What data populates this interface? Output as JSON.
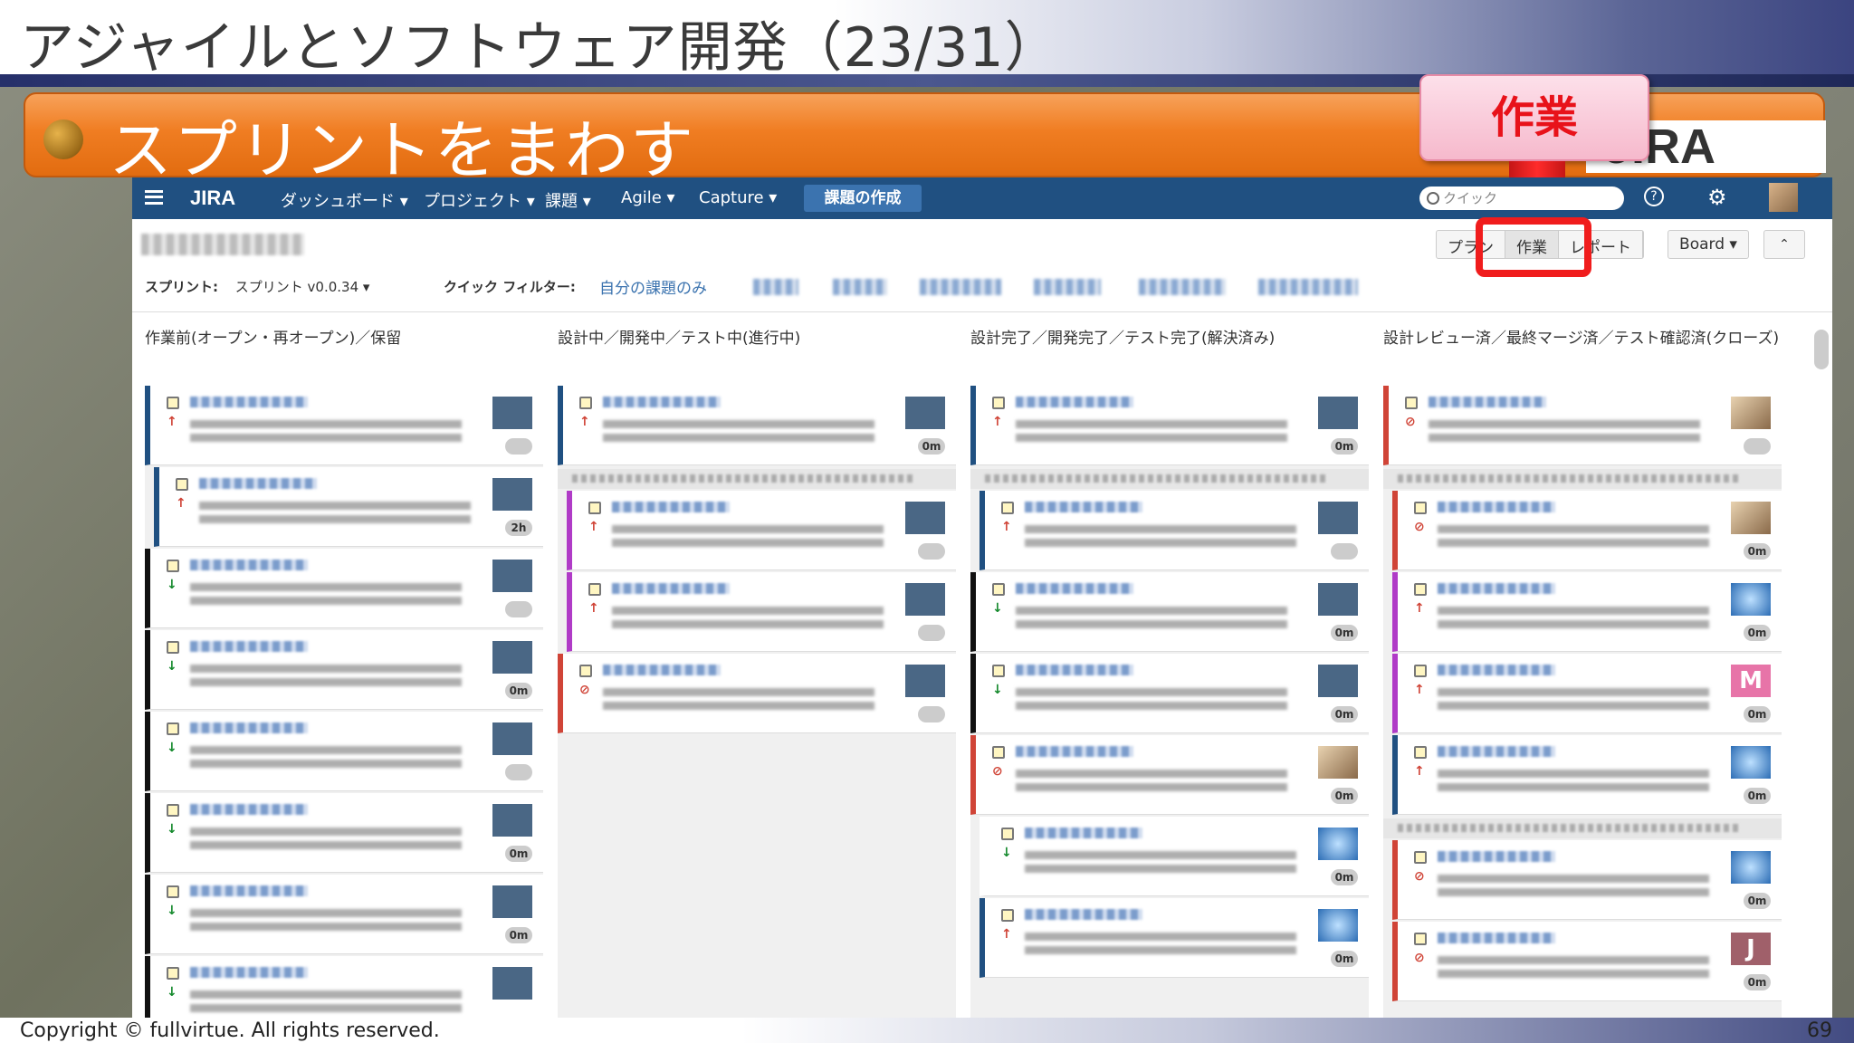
{
  "slide": {
    "title": "アジャイルとソフトウェア開発（23/31）",
    "banner": "スプリントをまわす",
    "logo_text": "JIRA Agile",
    "callout": "作業",
    "copyright": "Copyright © fullvirtue.  All rights reserved.",
    "page_number": "69"
  },
  "jira": {
    "nav": {
      "logo": "JIRA",
      "items": [
        "ダッシュボード ▾",
        "プロジェクト ▾",
        "課題 ▾",
        "Agile ▾",
        "Capture ▾"
      ],
      "create": "課題の作成",
      "search_placeholder": "クイック",
      "help": "?",
      "gear": "⚙"
    },
    "modes": [
      "プラン",
      "作業",
      "レポート"
    ],
    "board_button": "Board ▾",
    "collapse": "⌃",
    "sprint_label": "スプリント:",
    "sprint_value": "スプリント v0.0.34 ▾",
    "quick_filter_label": "クイック フィルター:",
    "quick_filter_mine": "自分の課題のみ",
    "columns": [
      "作業前(オープン・再オープン)／保留",
      "設計中／開発中／テスト中(進行中)",
      "設計完了／開発完了／テスト完了(解決済み)",
      "設計レビュー済／最終マージ済／テスト確認済(クローズ)"
    ],
    "estimates": [
      "2h",
      "0m",
      "M",
      "J"
    ]
  },
  "colors": {
    "nav": "#205081",
    "banner": "#f07d22",
    "callout_red": "#e8121a"
  }
}
